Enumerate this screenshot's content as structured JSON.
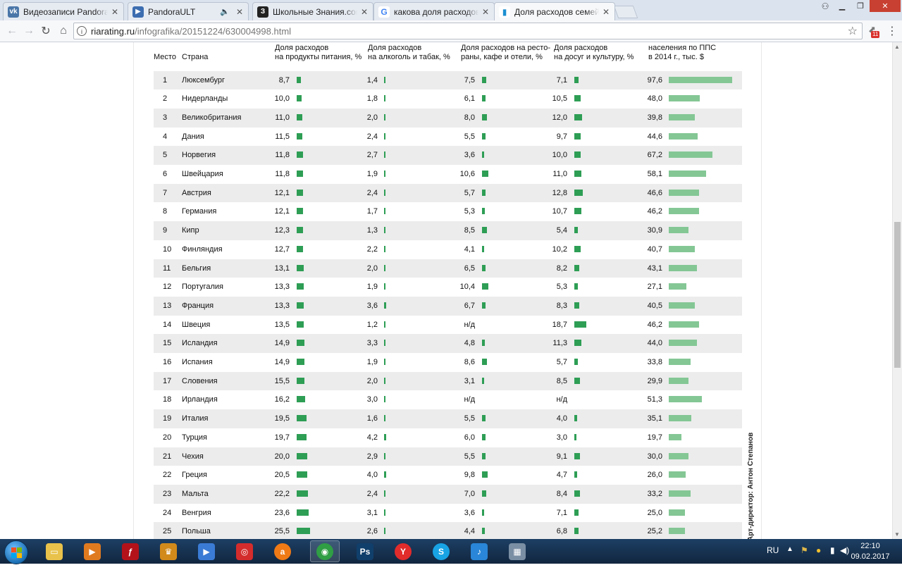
{
  "browser": {
    "tabs": [
      {
        "title": "Видеозаписи PandoraUL",
        "icon": "vk-icon",
        "color": "#4a76a8",
        "glyph": "vk"
      },
      {
        "title": "PandoraULT",
        "icon": "play-icon",
        "color": "#3c6db0",
        "glyph": "▶",
        "audio": true
      },
      {
        "title": "Школьные Знания.com",
        "icon": "znanija-icon",
        "color": "#222222",
        "glyph": "З"
      },
      {
        "title": "какова доля расходов н",
        "icon": "google-icon",
        "color": "#ffffff",
        "glyph": "G"
      },
      {
        "title": "Доля расходов семей н",
        "icon": "ria-rating-icon",
        "color": "#ffffff",
        "glyph": "▮",
        "active": true
      }
    ],
    "url_host": "riarating.ru",
    "url_path": "/infografika/20151224/630004998.html",
    "extension_badge": "11"
  },
  "table": {
    "headers": {
      "place": "Место",
      "country": "Страна",
      "food": [
        "Доля расходов",
        "на продукты питания, %"
      ],
      "alcohol": [
        "Доля расходов",
        "на алкоголь и табак, %"
      ],
      "restaurants": [
        "Доля расходов на ресто-",
        "раны, кафе и отели, %"
      ],
      "leisure": [
        "Доля расходов",
        "на досуг и культуру, %"
      ],
      "gdp": [
        "населения по ППС",
        "в 2014 г., тыс. $"
      ]
    },
    "rows": [
      {
        "place": "1",
        "country": "Люксембург",
        "food": "8,7",
        "alcohol": "1,4",
        "restaurants": "7,5",
        "leisure": "7,1",
        "gdp": "97,6"
      },
      {
        "place": "2",
        "country": "Нидерланды",
        "food": "10,0",
        "alcohol": "1,8",
        "restaurants": "6,1",
        "leisure": "10,5",
        "gdp": "48,0"
      },
      {
        "place": "3",
        "country": "Великобритания",
        "food": "11,0",
        "alcohol": "2,0",
        "restaurants": "8,0",
        "leisure": "12,0",
        "gdp": "39,8"
      },
      {
        "place": "4",
        "country": "Дания",
        "food": "11,5",
        "alcohol": "2,4",
        "restaurants": "5,5",
        "leisure": "9,7",
        "gdp": "44,6"
      },
      {
        "place": "5",
        "country": "Норвегия",
        "food": "11,8",
        "alcohol": "2,7",
        "restaurants": "3,6",
        "leisure": "10,0",
        "gdp": "67,2"
      },
      {
        "place": "6",
        "country": "Швейцария",
        "food": "11,8",
        "alcohol": "1,9",
        "restaurants": "10,6",
        "leisure": "11,0",
        "gdp": "58,1"
      },
      {
        "place": "7",
        "country": "Австрия",
        "food": "12,1",
        "alcohol": "2,4",
        "restaurants": "5,7",
        "leisure": "12,8",
        "gdp": "46,6"
      },
      {
        "place": "8",
        "country": "Германия",
        "food": "12,1",
        "alcohol": "1,7",
        "restaurants": "5,3",
        "leisure": "10,7",
        "gdp": "46,2"
      },
      {
        "place": "9",
        "country": "Кипр",
        "food": "12,3",
        "alcohol": "1,3",
        "restaurants": "8,5",
        "leisure": "5,4",
        "gdp": "30,9"
      },
      {
        "place": "10",
        "country": "Финляндия",
        "food": "12,7",
        "alcohol": "2,2",
        "restaurants": "4,1",
        "leisure": "10,2",
        "gdp": "40,7"
      },
      {
        "place": "11",
        "country": "Бельгия",
        "food": "13,1",
        "alcohol": "2,0",
        "restaurants": "6,5",
        "leisure": "8,2",
        "gdp": "43,1"
      },
      {
        "place": "12",
        "country": "Португалия",
        "food": "13,3",
        "alcohol": "1,9",
        "restaurants": "10,4",
        "leisure": "5,3",
        "gdp": "27,1"
      },
      {
        "place": "13",
        "country": "Франция",
        "food": "13,3",
        "alcohol": "3,6",
        "restaurants": "6,7",
        "leisure": "8,3",
        "gdp": "40,5"
      },
      {
        "place": "14",
        "country": "Швеция",
        "food": "13,5",
        "alcohol": "1,2",
        "restaurants": "н/д",
        "leisure": "18,7",
        "gdp": "46,2"
      },
      {
        "place": "15",
        "country": "Исландия",
        "food": "14,9",
        "alcohol": "3,3",
        "restaurants": "4,8",
        "leisure": "11,3",
        "gdp": "44,0"
      },
      {
        "place": "16",
        "country": "Испания",
        "food": "14,9",
        "alcohol": "1,9",
        "restaurants": "8,6",
        "leisure": "5,7",
        "gdp": "33,8"
      },
      {
        "place": "17",
        "country": "Словения",
        "food": "15,5",
        "alcohol": "2,0",
        "restaurants": "3,1",
        "leisure": "8,5",
        "gdp": "29,9"
      },
      {
        "place": "18",
        "country": "Ирландия",
        "food": "16,2",
        "alcohol": "3,0",
        "restaurants": "н/д",
        "leisure": "н/д",
        "gdp": "51,3"
      },
      {
        "place": "19",
        "country": "Италия",
        "food": "19,5",
        "alcohol": "1,6",
        "restaurants": "5,5",
        "leisure": "4,0",
        "gdp": "35,1"
      },
      {
        "place": "20",
        "country": "Турция",
        "food": "19,7",
        "alcohol": "4,2",
        "restaurants": "6,0",
        "leisure": "3,0",
        "gdp": "19,7"
      },
      {
        "place": "21",
        "country": "Чехия",
        "food": "20,0",
        "alcohol": "2,9",
        "restaurants": "5,5",
        "leisure": "9,1",
        "gdp": "30,0"
      },
      {
        "place": "22",
        "country": "Греция",
        "food": "20,5",
        "alcohol": "4,0",
        "restaurants": "9,8",
        "leisure": "4,7",
        "gdp": "26,0"
      },
      {
        "place": "23",
        "country": "Мальта",
        "food": "22,2",
        "alcohol": "2,4",
        "restaurants": "7,0",
        "leisure": "8,4",
        "gdp": "33,2"
      },
      {
        "place": "24",
        "country": "Венгрия",
        "food": "23,6",
        "alcohol": "3,1",
        "restaurants": "3,6",
        "leisure": "7,1",
        "gdp": "25,0"
      },
      {
        "place": "25",
        "country": "Польша",
        "food": "25,5",
        "alcohol": "2,6",
        "restaurants": "4,4",
        "leisure": "6,8",
        "gdp": "25,2"
      }
    ],
    "bar_color": "#2e9e55",
    "gdp_bar_color": "#84c795",
    "credit": "Арт-директор: Антон Степанов"
  },
  "taskbar": {
    "apps": [
      {
        "name": "explorer",
        "icon": "folder-icon",
        "color": "#e8c24a",
        "glyph": "▭"
      },
      {
        "name": "media-player",
        "icon": "media-icon",
        "color": "#e07a1f",
        "glyph": "▶"
      },
      {
        "name": "flash",
        "icon": "flash-icon",
        "color": "#b3121b",
        "glyph": "ƒ"
      },
      {
        "name": "crown",
        "icon": "crown-icon",
        "color": "#d28a1a",
        "glyph": "♛"
      },
      {
        "name": "player",
        "icon": "play-button-icon",
        "color": "#3a7bd5",
        "glyph": "▶"
      },
      {
        "name": "antivirus",
        "icon": "shield-icon",
        "color": "#d42c2c",
        "glyph": "◎"
      },
      {
        "name": "avast",
        "icon": "avast-icon",
        "color": "#f07a15",
        "glyph": "a"
      },
      {
        "name": "chrome",
        "icon": "chrome-icon",
        "color": "#2f9e44",
        "glyph": "◉",
        "active": true
      },
      {
        "name": "photoshop",
        "icon": "photoshop-icon",
        "color": "#103f6b",
        "glyph": "Ps"
      },
      {
        "name": "yandex",
        "icon": "yandex-icon",
        "color": "#e22b2b",
        "glyph": "Y"
      },
      {
        "name": "skype",
        "icon": "skype-icon",
        "color": "#18a3e4",
        "glyph": "S"
      },
      {
        "name": "music",
        "icon": "music-icon",
        "color": "#2a86d8",
        "glyph": "♪"
      },
      {
        "name": "calculator",
        "icon": "calculator-icon",
        "color": "#7a8ea4",
        "glyph": "▦"
      }
    ],
    "lang": "RU",
    "time": "22:10",
    "date": "09.02.2017"
  }
}
